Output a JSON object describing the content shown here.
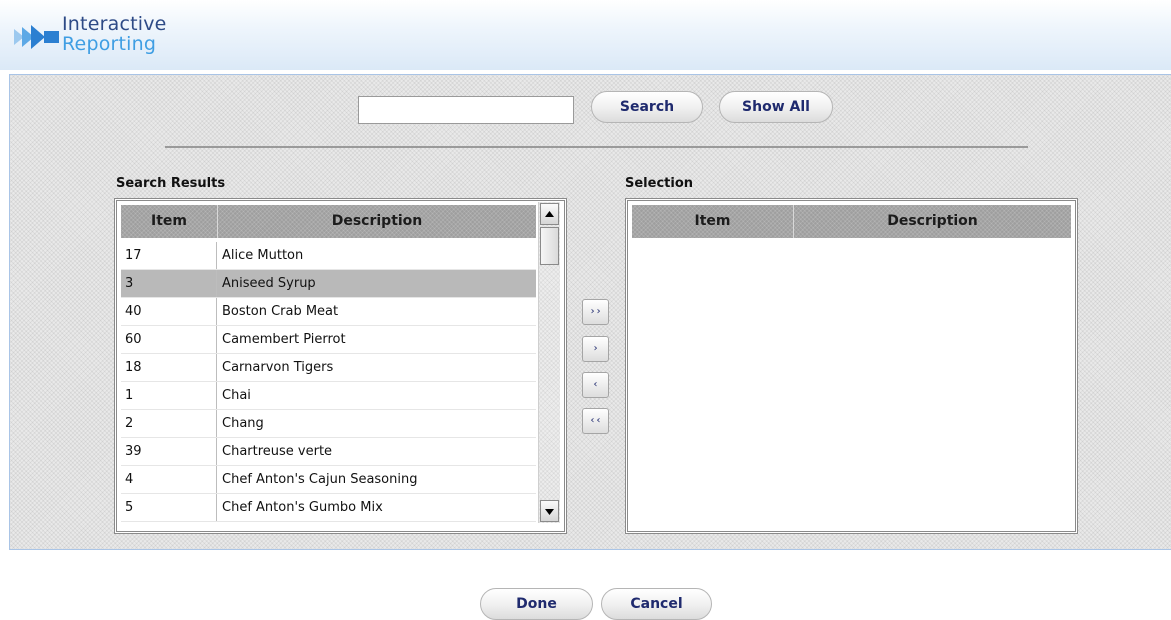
{
  "header": {
    "logo_line1": "Interactive",
    "logo_line2": "Reporting"
  },
  "search": {
    "value": "",
    "placeholder": "",
    "search_label": "Search",
    "show_all_label": "Show All"
  },
  "results": {
    "title": "Search Results",
    "col_item": "Item",
    "col_desc": "Description",
    "rows": [
      {
        "item": "17",
        "desc": "Alice Mutton"
      },
      {
        "item": "3",
        "desc": "Aniseed Syrup"
      },
      {
        "item": "40",
        "desc": "Boston Crab Meat"
      },
      {
        "item": "60",
        "desc": "Camembert Pierrot"
      },
      {
        "item": "18",
        "desc": "Carnarvon Tigers"
      },
      {
        "item": "1",
        "desc": "Chai"
      },
      {
        "item": "2",
        "desc": "Chang"
      },
      {
        "item": "39",
        "desc": "Chartreuse verte"
      },
      {
        "item": "4",
        "desc": "Chef Anton's Cajun Seasoning"
      },
      {
        "item": "5",
        "desc": "Chef Anton's Gumbo Mix"
      }
    ],
    "selected_row": 1
  },
  "transfer": {
    "add_all": "››",
    "add": "›",
    "remove": "‹",
    "remove_all": "‹‹"
  },
  "selection": {
    "title": "Selection",
    "col_item": "Item",
    "col_desc": "Description"
  },
  "footer": {
    "done_label": "Done",
    "cancel_label": "Cancel"
  },
  "colors": {
    "logo_dark": "#2d4a86",
    "logo_light": "#3f9ee3",
    "button_text": "#1f2a6e",
    "selected_row": "#b9b9b9"
  }
}
